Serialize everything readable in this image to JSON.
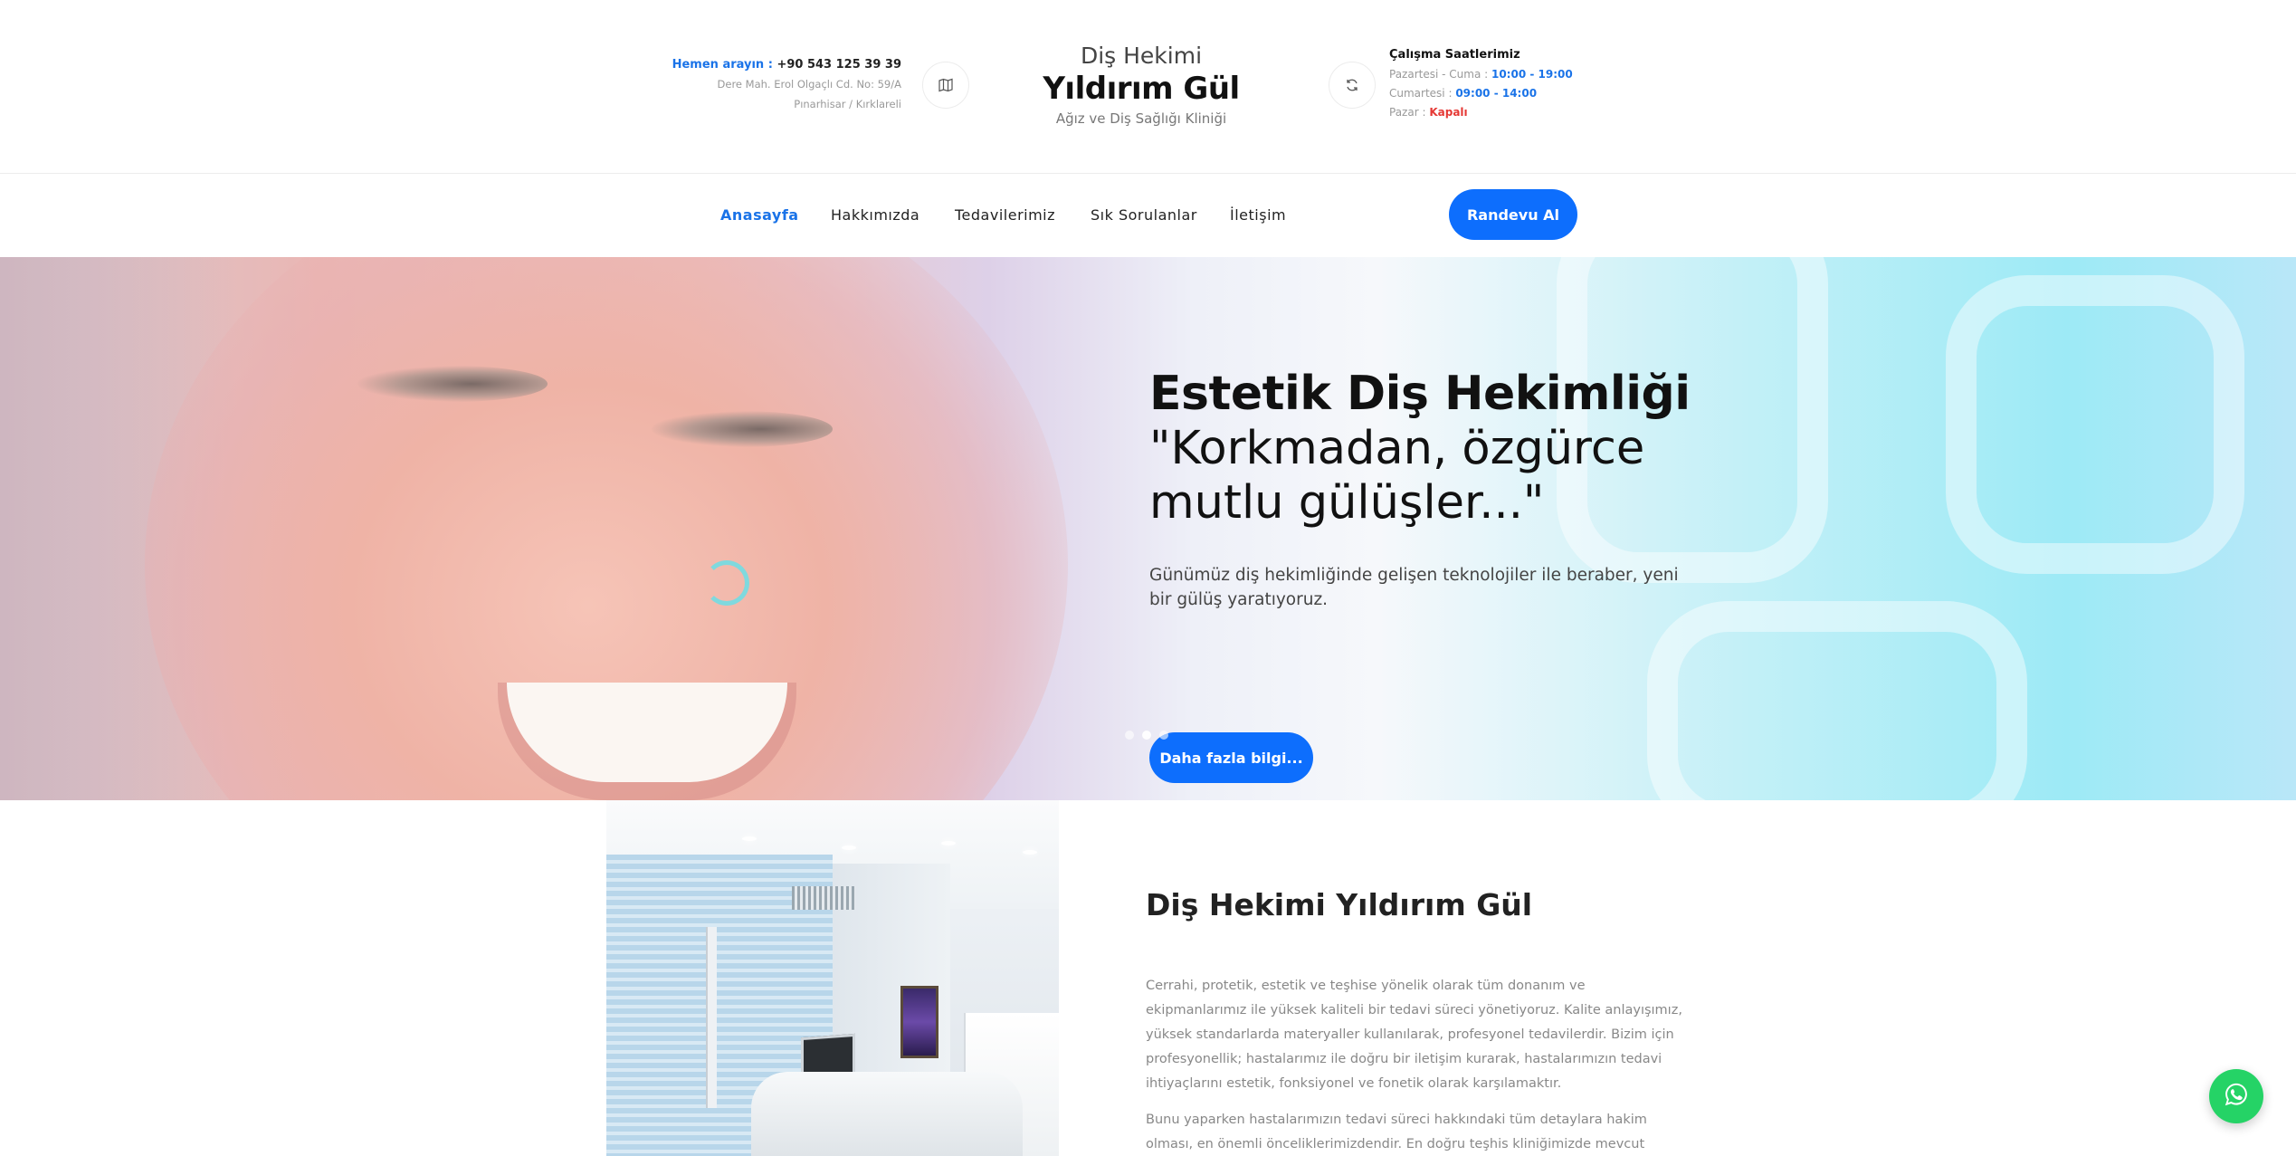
{
  "header": {
    "call_label": "Hemen arayın :",
    "phone": "+90 543 125 39 39",
    "address_line1": "Dere Mah. Erol Olgaçlı Cd. No: 59/A",
    "address_line2": "Pınarhisar / Kırklareli",
    "logo_top": "Diş Hekimi",
    "logo_main": "Yıldırım Gül",
    "logo_sub": "Ağız ve Diş Sağlığı Kliniği",
    "hours_title": "Çalışma Saatlerimiz",
    "hours": [
      {
        "day": "Pazartesi - Cuma :",
        "value": "10:00 - 19:00"
      },
      {
        "day": "Cumartesi :",
        "value": "09:00 - 14:00"
      },
      {
        "day": "Pazar :",
        "value": "Kapalı"
      }
    ],
    "icons": {
      "map": "map-icon",
      "hours": "refresh-icon"
    }
  },
  "nav": {
    "items": [
      "Anasayfa",
      "Hakkımızda",
      "Tedavilerimiz",
      "Sık Sorulanlar",
      "İletişim"
    ],
    "active": "Anasayfa",
    "cta": "Randevu Al"
  },
  "hero": {
    "title": "Estetik Diş Hekimliği",
    "quote": "\"Korkmadan, özgürce mutlu gülüşler...\"",
    "description": "Günümüz diş hekimliğinde gelişen teknolojiler ile beraber, yeni bir gülüş yaratıyoruz.",
    "button": "Daha fazla bilgi...",
    "slides": 3,
    "active_slide": 2
  },
  "about": {
    "title": "Diş Hekimi Yıldırım Gül",
    "paragraph1": "Cerrahi, protetik, estetik ve teşhise yönelik olarak tüm donanım ve ekipmanlarımız ile yüksek kaliteli bir tedavi süreci yönetiyoruz. Kalite anlayışımız, yüksek standarlarda materyaller kullanılarak, profesyonel tedavilerdir. Bizim için profesyonellik; hastalarımız ile doğru bir iletişim kurarak, hastalarımızın tedavi ihtiyaçlarını estetik, fonksiyonel ve fonetik olarak karşılamaktır.",
    "paragraph2": "Bunu yaparken hastalarımızın tedavi süreci hakkındaki tüm detaylara hakim olması, en önemli önceliklerimizdendir. En doğru teşhis kliniğimizde mevcut"
  },
  "colors": {
    "accent": "#0d6efd",
    "closed": "#e53935",
    "whatsapp": "#25d366"
  },
  "floating": {
    "icon": "whatsapp-icon"
  }
}
